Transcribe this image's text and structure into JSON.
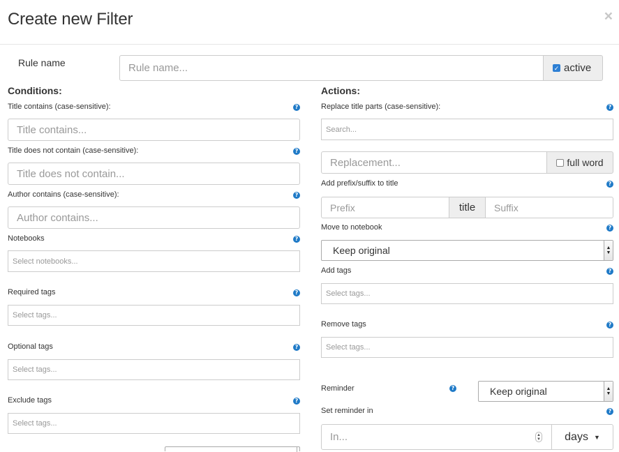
{
  "dialog": {
    "title": "Create new Filter",
    "close_label": "×"
  },
  "rule": {
    "label": "Rule name",
    "placeholder": "Rule name...",
    "active_label": "active",
    "active_checked": true
  },
  "conditions": {
    "title": "Conditions:",
    "title_contains": {
      "label": "Title contains (case-sensitive):",
      "placeholder": "Title contains..."
    },
    "title_not_contains": {
      "label": "Title does not contain (case-sensitive):",
      "placeholder": "Title does not contain..."
    },
    "author_contains": {
      "label": "Author contains (case-sensitive):",
      "placeholder": "Author contains..."
    },
    "notebooks": {
      "label": "Notebooks",
      "placeholder": "Select notebooks..."
    },
    "required_tags": {
      "label": "Required tags",
      "placeholder": "Select tags..."
    },
    "optional_tags": {
      "label": "Optional tags",
      "placeholder": "Select tags..."
    },
    "exclude_tags": {
      "label": "Exclude tags",
      "placeholder": "Select tags..."
    }
  },
  "actions": {
    "title": "Actions:",
    "replace_title": {
      "label": "Replace title parts (case-sensitive):",
      "search_placeholder": "Search...",
      "replacement_placeholder": "Replacement...",
      "full_word_label": "full word"
    },
    "prefix_suffix": {
      "label": "Add prefix/suffix to title",
      "prefix_placeholder": "Prefix",
      "middle_label": "title",
      "suffix_placeholder": "Suffix"
    },
    "move_notebook": {
      "label": "Move to notebook",
      "selected": "Keep original"
    },
    "add_tags": {
      "label": "Add tags",
      "placeholder": "Select tags..."
    },
    "remove_tags": {
      "label": "Remove tags",
      "placeholder": "Select tags..."
    },
    "reminder": {
      "label": "Reminder",
      "selected": "Keep original"
    },
    "set_reminder": {
      "label": "Set reminder in",
      "placeholder": "In...",
      "unit_label": "days"
    }
  },
  "help_icon_name": "question-circle-icon",
  "accent_color": "#1f7ac7"
}
